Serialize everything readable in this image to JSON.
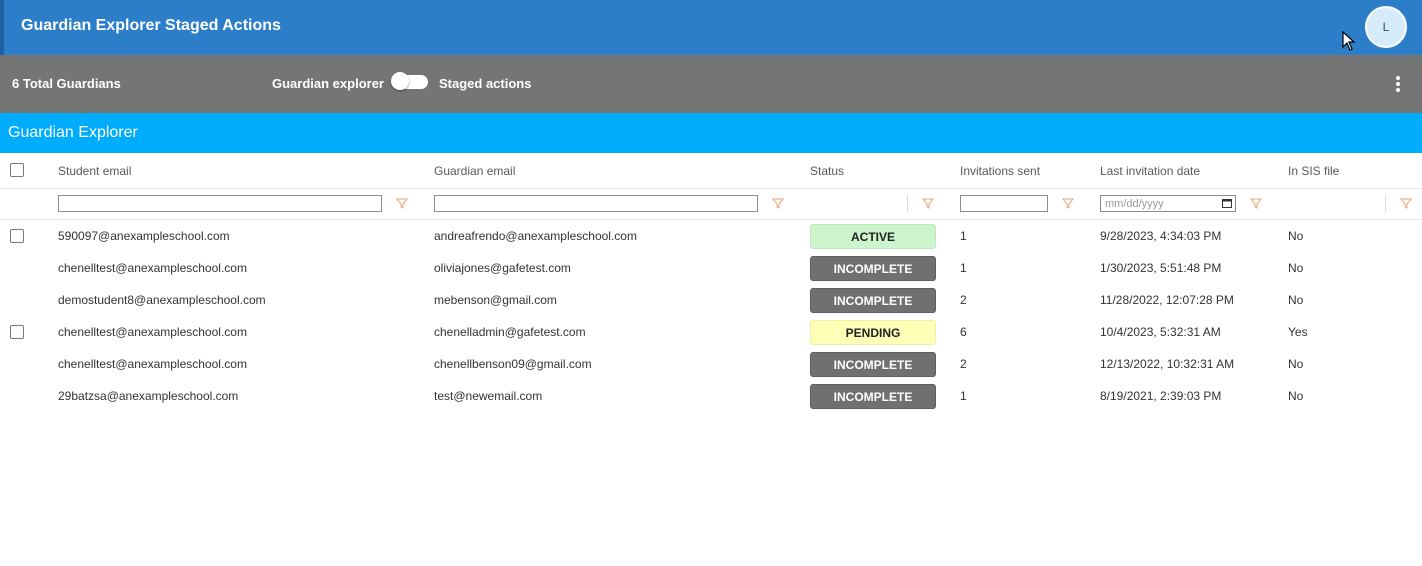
{
  "app": {
    "title": "Guardian Explorer Staged Actions",
    "avatar_initial": "L"
  },
  "toolbar": {
    "total": "6 Total Guardians",
    "toggle_left_label": "Guardian explorer",
    "toggle_right_label": "Staged actions"
  },
  "section": {
    "title": "Guardian Explorer"
  },
  "columns": {
    "student_email": "Student email",
    "guardian_email": "Guardian email",
    "status": "Status",
    "invitations_sent": "Invitations sent",
    "last_invitation_date": "Last invitation date",
    "in_sis_file": "In SIS file"
  },
  "filters": {
    "date_placeholder": "mm/dd/yyyy"
  },
  "rows": [
    {
      "student": "590097@anexampleschool.com",
      "guardian": "andreafrendo@anexampleschool.com",
      "status": "ACTIVE",
      "invitations": "1",
      "date": "9/28/2023, 4:34:03 PM",
      "sis": "No"
    },
    {
      "student": "chenelltest@anexampleschool.com",
      "guardian": "oliviajones@gafetest.com",
      "status": "INCOMPLETE",
      "invitations": "1",
      "date": "1/30/2023, 5:51:48 PM",
      "sis": "No"
    },
    {
      "student": "demostudent8@anexampleschool.com",
      "guardian": "mebenson@gmail.com",
      "status": "INCOMPLETE",
      "invitations": "2",
      "date": "11/28/2022, 12:07:28 PM",
      "sis": "No"
    },
    {
      "student": "chenelltest@anexampleschool.com",
      "guardian": "chenelladmin@gafetest.com",
      "status": "PENDING",
      "invitations": "6",
      "date": "10/4/2023, 5:32:31 AM",
      "sis": "Yes"
    },
    {
      "student": "chenelltest@anexampleschool.com",
      "guardian": "chenellbenson09@gmail.com",
      "status": "INCOMPLETE",
      "invitations": "2",
      "date": "12/13/2022, 10:32:31 AM",
      "sis": "No"
    },
    {
      "student": "29batzsa@anexampleschool.com",
      "guardian": "test@newemail.com",
      "status": "INCOMPLETE",
      "invitations": "1",
      "date": "8/19/2021, 2:39:03 PM",
      "sis": "No"
    }
  ],
  "colors": {
    "appbar": "#2c7ec9",
    "toolbar": "#757575",
    "section": "#00adfd",
    "active": "#cdf5cd",
    "incomplete": "#707070",
    "pending": "#fefeb6",
    "filter_icon": "#e0a070"
  }
}
